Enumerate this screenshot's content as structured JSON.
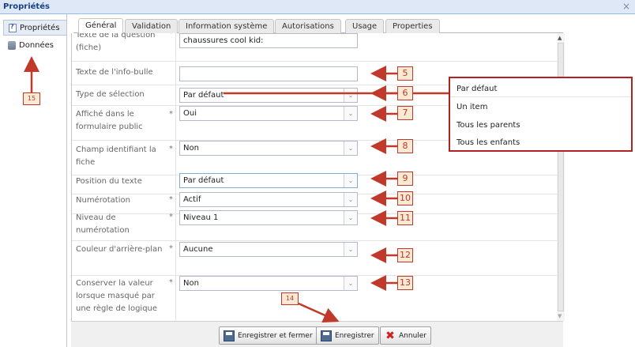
{
  "window": {
    "title": "Propriétés",
    "close_glyph": "×"
  },
  "sidebar": {
    "items": [
      {
        "label": "Propriétés",
        "icon": "properties-icon"
      },
      {
        "label": "Données",
        "icon": "database-icon"
      }
    ]
  },
  "tabs": [
    "Général",
    "Validation",
    "Information système",
    "Autorisations",
    "Usage",
    "Properties"
  ],
  "form": {
    "rows": [
      {
        "label": "Texte de la question (fiche)",
        "required": "*",
        "value": "chaussures cool kid:"
      },
      {
        "label": "Texte de l'info-bulle",
        "required": "",
        "value": ""
      },
      {
        "label": "Type de sélection",
        "required": "",
        "value": "Par défaut"
      },
      {
        "label": "Affiché dans le formulaire public",
        "required": "*",
        "value": "Oui"
      },
      {
        "label": "Champ identifiant la fiche",
        "required": "*",
        "value": "Non"
      },
      {
        "label": "Position du texte",
        "required": "",
        "value": "Par défaut"
      },
      {
        "label": "Numérotation",
        "required": "*",
        "value": "Actif"
      },
      {
        "label": "Niveau de numérotation",
        "required": "*",
        "value": "Niveau 1"
      },
      {
        "label": "Couleur d'arrière-plan",
        "required": "*",
        "value": "Aucune"
      },
      {
        "label": "Conserver la valeur lorsque masqué par une règle de logique",
        "required": "*",
        "value": "Non"
      }
    ]
  },
  "popup": {
    "options": [
      "Par défaut",
      "Un item",
      "Tous les parents",
      "Tous les enfants"
    ]
  },
  "footer": {
    "save_close_label": "Enregistrer et fermer",
    "save_label": "Enregistrer",
    "cancel_label": "Annuler"
  },
  "callouts": [
    "5",
    "6",
    "7",
    "8",
    "9",
    "10",
    "11",
    "12",
    "13",
    "14",
    "15"
  ],
  "colors": {
    "annotation": "#c0392b",
    "header_bg": "#dfe8f6",
    "header_text": "#15428b"
  }
}
